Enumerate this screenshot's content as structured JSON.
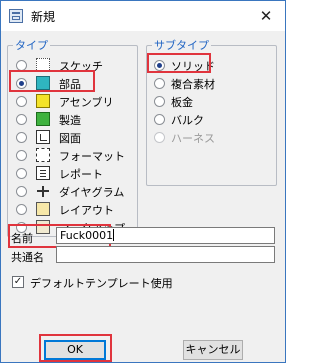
{
  "window": {
    "title": "新規",
    "close_symbol": "✕"
  },
  "type_group": {
    "legend": "タイプ",
    "items": [
      {
        "label": "スケッチ",
        "icon": "sketch-icon",
        "selected": false
      },
      {
        "label": "部品",
        "icon": "part-icon",
        "selected": true
      },
      {
        "label": "アセンブリ",
        "icon": "assembly-icon",
        "selected": false
      },
      {
        "label": "製造",
        "icon": "manufacturing-icon",
        "selected": false
      },
      {
        "label": "図面",
        "icon": "drawing-icon",
        "selected": false
      },
      {
        "label": "フォーマット",
        "icon": "format-icon",
        "selected": false
      },
      {
        "label": "レポート",
        "icon": "report-icon",
        "selected": false
      },
      {
        "label": "ダイヤグラム",
        "icon": "diagram-icon",
        "selected": false
      },
      {
        "label": "レイアウト",
        "icon": "layout-icon",
        "selected": false
      },
      {
        "label": "マークアップ",
        "icon": "markup-icon",
        "selected": false
      }
    ]
  },
  "subtype_group": {
    "legend": "サブタイプ",
    "items": [
      {
        "label": "ソリッド",
        "selected": true,
        "enabled": true
      },
      {
        "label": "複合素材",
        "selected": false,
        "enabled": true
      },
      {
        "label": "板金",
        "selected": false,
        "enabled": true
      },
      {
        "label": "バルク",
        "selected": false,
        "enabled": true
      },
      {
        "label": "ハーネス",
        "selected": false,
        "enabled": false
      }
    ]
  },
  "fields": {
    "name_label": "名前",
    "name_value": "Fuck0001",
    "common_name_label": "共通名",
    "common_name_value": ""
  },
  "options": {
    "use_default_template_label": "デフォルトテンプレート使用",
    "use_default_template_checked": true,
    "check_mark": "✓"
  },
  "buttons": {
    "ok_label": "OK",
    "cancel_label": "キャンセル"
  },
  "colors": {
    "highlight": "#e0343d",
    "legend_text": "#2366c4",
    "window_border": "#3a76bf"
  }
}
